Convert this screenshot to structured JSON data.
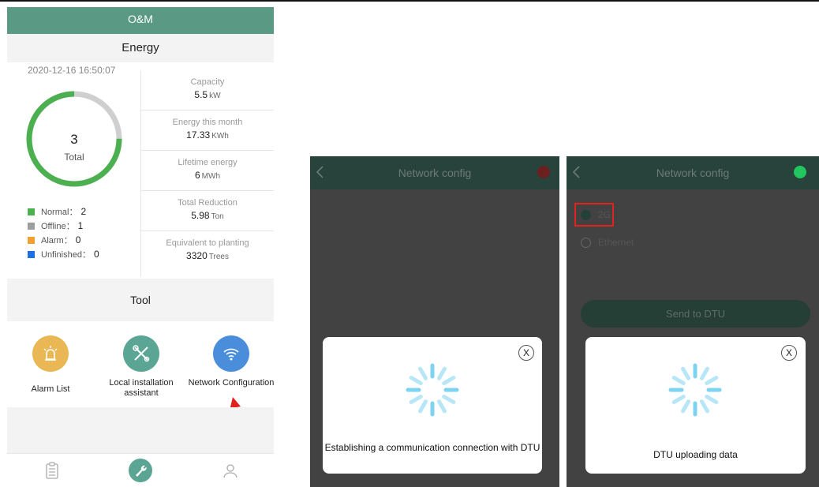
{
  "screen1": {
    "title": "O&M",
    "energy_header": "Energy",
    "datetime": "2020-12-16 16:50:07",
    "total": {
      "number": "3",
      "label": "Total",
      "online_fraction": 0.75
    },
    "legend": [
      {
        "label": "Normal：",
        "value": "2",
        "color": "#4caf50"
      },
      {
        "label": "Offline：",
        "value": "1",
        "color": "#9e9e9e"
      },
      {
        "label": "Alarm：",
        "value": "0",
        "color": "#f0a030"
      },
      {
        "label": "Unfinished：",
        "value": "0",
        "color": "#1e6fe0"
      }
    ],
    "stats": [
      {
        "label": "Capacity",
        "value": "5.5",
        "unit": "kW"
      },
      {
        "label": "Energy this month",
        "value": "17.33",
        "unit": "KWh"
      },
      {
        "label": "Lifetime energy",
        "value": "6",
        "unit": "MWh"
      },
      {
        "label": "Total Reduction",
        "value": "5.98",
        "unit": "Ton"
      },
      {
        "label": "Equivalent to planting",
        "value": "3320",
        "unit": "Trees"
      }
    ],
    "tool_header": "Tool",
    "tools": [
      {
        "label": "Alarm List",
        "icon": "alarm-icon",
        "color": "#eab755"
      },
      {
        "label": "Local installation assistant",
        "icon": "tools-icon",
        "color": "#5aa593"
      },
      {
        "label": "Network Configuration",
        "icon": "wifi-icon",
        "color": "#4a8edb"
      }
    ],
    "tabs": [
      {
        "icon": "clipboard-icon"
      },
      {
        "icon": "wrench-icon",
        "active": true
      },
      {
        "icon": "user-icon"
      }
    ]
  },
  "screen2": {
    "nav_title": "Network config",
    "status_color": "#d32f2f",
    "dialog_close": "X",
    "dialog_text": "Establishing a communication connection with DTU"
  },
  "screen3": {
    "nav_title": "Network config",
    "status_color": "#22c55e",
    "options": [
      {
        "label": "2G",
        "selected": true
      },
      {
        "label": "Ethernet",
        "selected": false
      }
    ],
    "send_button": "Send to DTU",
    "dialog_close": "X",
    "dialog_text": "DTU uploading data"
  }
}
